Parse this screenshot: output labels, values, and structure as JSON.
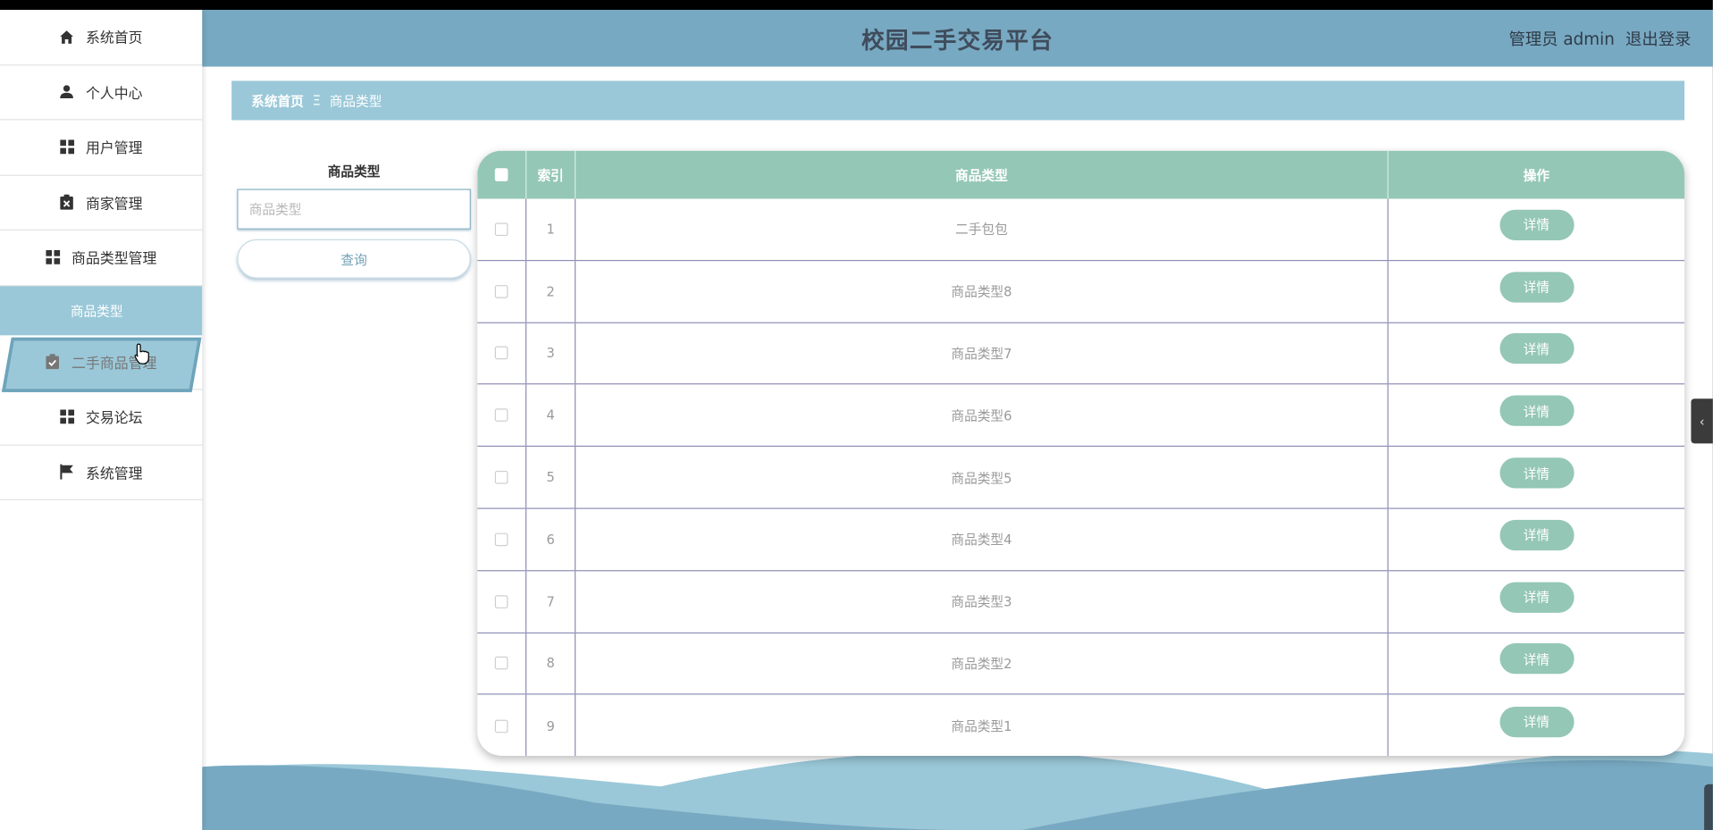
{
  "header": {
    "title": "校园二手交易平台",
    "user": "管理员 admin",
    "logout": "退出登录"
  },
  "sidebar": {
    "items": [
      {
        "label": "系统首页",
        "icon": "home-icon"
      },
      {
        "label": "个人中心",
        "icon": "user-icon"
      },
      {
        "label": "用户管理",
        "icon": "grid-icon"
      },
      {
        "label": "商家管理",
        "icon": "clipboard-x-icon"
      },
      {
        "label": "商品类型管理",
        "icon": "grid-icon"
      },
      {
        "label": "商品类型",
        "sub": true
      },
      {
        "label": "二手商品管理",
        "icon": "clipboard-check-icon"
      },
      {
        "label": "交易论坛",
        "icon": "grid-icon"
      },
      {
        "label": "系统管理",
        "icon": "flag-icon"
      }
    ]
  },
  "breadcrumb": {
    "home": "系统首页",
    "sep": "Ξ",
    "current": "商品类型"
  },
  "search": {
    "label": "商品类型",
    "placeholder": "商品类型",
    "button": "查询"
  },
  "table": {
    "headers": {
      "index": "索引",
      "type": "商品类型",
      "action": "操作"
    },
    "rows": [
      {
        "index": "1",
        "type": "二手包包",
        "action": "详情"
      },
      {
        "index": "2",
        "type": "商品类型8",
        "action": "详情"
      },
      {
        "index": "3",
        "type": "商品类型7",
        "action": "详情"
      },
      {
        "index": "4",
        "type": "商品类型6",
        "action": "详情"
      },
      {
        "index": "5",
        "type": "商品类型5",
        "action": "详情"
      },
      {
        "index": "6",
        "type": "商品类型4",
        "action": "详情"
      },
      {
        "index": "7",
        "type": "商品类型3",
        "action": "详情"
      },
      {
        "index": "8",
        "type": "商品类型2",
        "action": "详情"
      },
      {
        "index": "9",
        "type": "商品类型1",
        "action": "详情"
      }
    ]
  },
  "colors": {
    "header": "#78a9c2",
    "accent": "#9ac8d8",
    "table_head": "#94c7b5",
    "wave_dark": "#78a9c2",
    "wave_light": "#9ac8d8"
  },
  "right_tab": {
    "glyph": "‹"
  }
}
